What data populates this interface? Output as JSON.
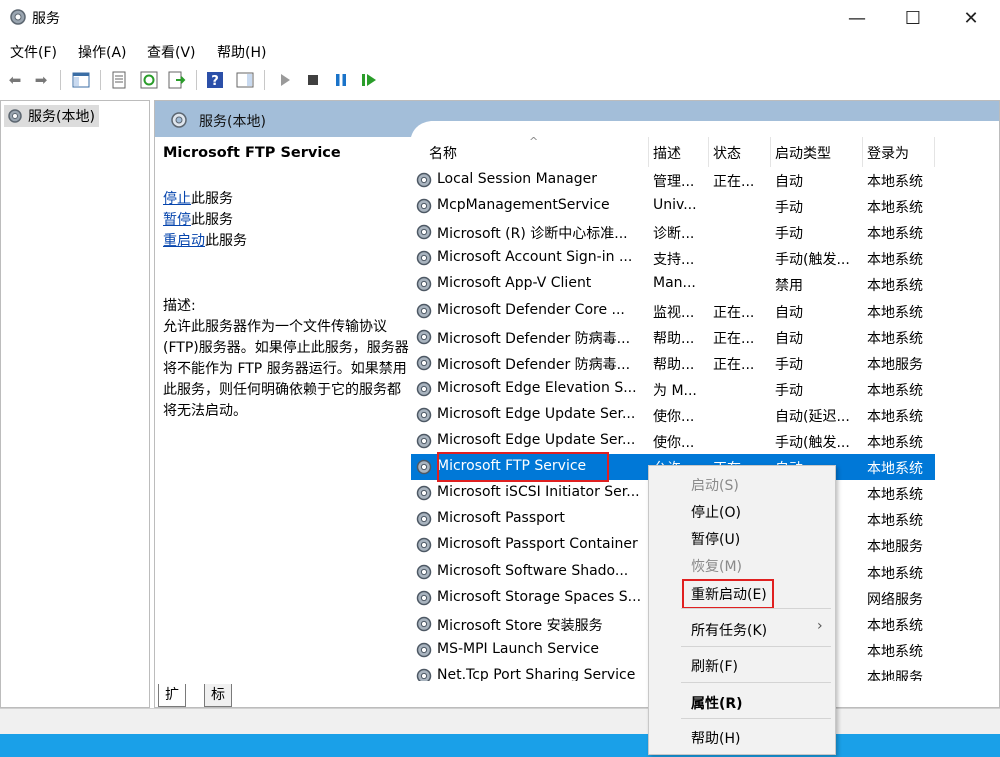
{
  "window": {
    "title": "服务",
    "minimize": "—",
    "maximize": "☐",
    "close": "✕"
  },
  "menu": [
    "文件(F)",
    "操作(A)",
    "查看(V)",
    "帮助(H)"
  ],
  "toolbar": {
    "help_icon": "?"
  },
  "tree": {
    "root": "服务(本地)"
  },
  "panel": {
    "title": "服务(本地)"
  },
  "detail": {
    "service_name": "Microsoft FTP Service",
    "stop_link": "停止",
    "stop_suffix": "此服务",
    "pause_link": "暂停",
    "pause_suffix": "此服务",
    "restart_link": "重启动",
    "restart_suffix": "此服务",
    "desc_label": "描述:",
    "desc_text": "允许此服务器作为一个文件传输协议(FTP)服务器。如果停止此服务，服务器将不能作为 FTP 服务器运行。如果禁用此服务，则任何明确依赖于它的服务都将无法启动。"
  },
  "columns": [
    "名称",
    "描述",
    "状态",
    "启动类型",
    "登录为"
  ],
  "rows": [
    [
      "Local Session Manager",
      "管理...",
      "正在...",
      "自动",
      "本地系统"
    ],
    [
      "McpManagementService",
      "Univ...",
      "",
      "手动",
      "本地系统"
    ],
    [
      "Microsoft (R) 诊断中心标准...",
      "诊断...",
      "",
      "手动",
      "本地系统"
    ],
    [
      "Microsoft Account Sign-in ...",
      "支持...",
      "",
      "手动(触发...",
      "本地系统"
    ],
    [
      "Microsoft App-V Client",
      "Man...",
      "",
      "禁用",
      "本地系统"
    ],
    [
      "Microsoft Defender Core ...",
      "监视...",
      "正在...",
      "自动",
      "本地系统"
    ],
    [
      "Microsoft Defender 防病毒...",
      "帮助...",
      "正在...",
      "自动",
      "本地系统"
    ],
    [
      "Microsoft Defender 防病毒...",
      "帮助...",
      "正在...",
      "手动",
      "本地服务"
    ],
    [
      "Microsoft Edge Elevation S...",
      "为 M...",
      "",
      "手动",
      "本地系统"
    ],
    [
      "Microsoft Edge Update Ser...",
      "使你...",
      "",
      "自动(延迟...",
      "本地系统"
    ],
    [
      "Microsoft Edge Update Ser...",
      "使你...",
      "",
      "手动(触发...",
      "本地系统"
    ],
    [
      "Microsoft FTP Service",
      "允许...",
      "正在...",
      "自动",
      "本地系统"
    ],
    [
      "Microsoft iSCSI Initiator Ser...",
      "",
      "",
      "",
      "本地系统"
    ],
    [
      "Microsoft Passport",
      "",
      "",
      "...",
      "本地系统"
    ],
    [
      "Microsoft Passport Container",
      "",
      "",
      "",
      "本地服务"
    ],
    [
      "Microsoft Software Shado...",
      "",
      "",
      "",
      "本地系统"
    ],
    [
      "Microsoft Storage Spaces S...",
      "",
      "",
      "",
      "网络服务"
    ],
    [
      "Microsoft Store 安装服务",
      "",
      "",
      "",
      "本地系统"
    ],
    [
      "MS-MPI Launch Service",
      "",
      "",
      "",
      "本地系统"
    ],
    [
      "Net.Tcp Port Sharing Service",
      "",
      "",
      "",
      "本地服务"
    ]
  ],
  "selected_row_index": 11,
  "tabs": [
    "扩展",
    "标准"
  ],
  "context_menu": {
    "start": "启动(S)",
    "stop": "停止(O)",
    "pause": "暂停(U)",
    "resume": "恢复(M)",
    "restart": "重新启动(E)",
    "all_tasks": "所有任务(K)",
    "all_tasks_arrow": "›",
    "refresh": "刷新(F)",
    "properties": "属性(R)",
    "help": "帮助(H)"
  },
  "colors": {
    "selection": "#0078d7",
    "panel_header": "#a3bed9",
    "taskbar": "#1aa0e8",
    "highlight_box": "#e02020"
  }
}
